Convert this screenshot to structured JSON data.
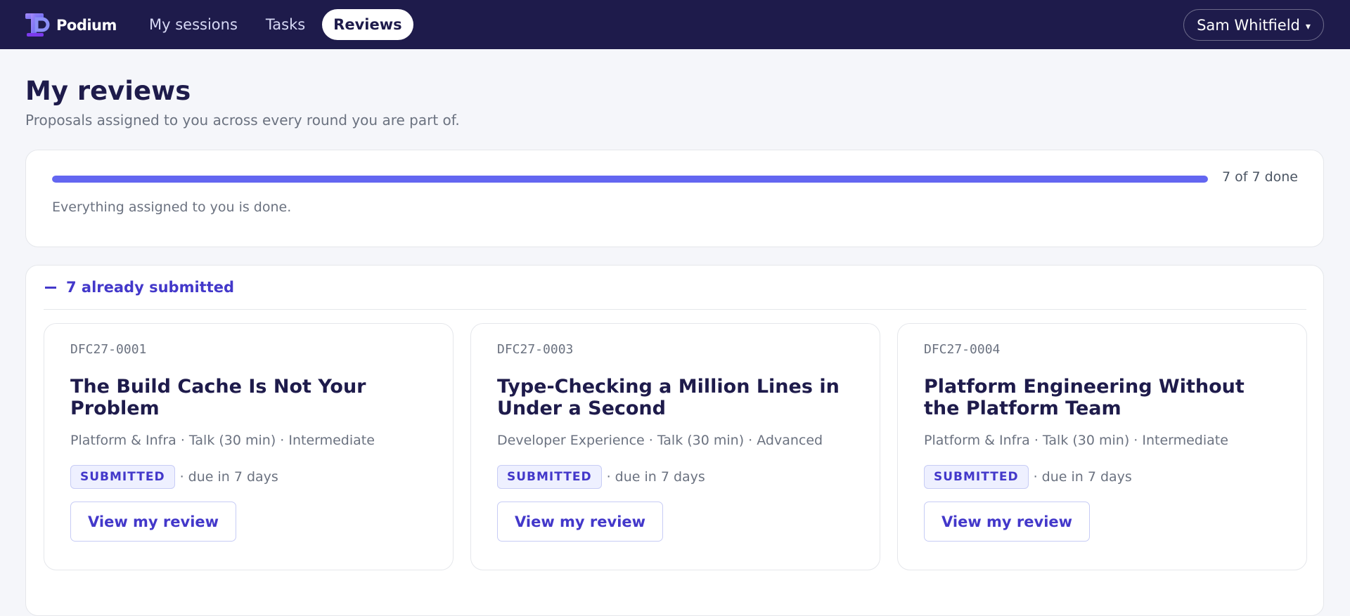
{
  "app": {
    "name": "Podium"
  },
  "nav": {
    "items": [
      {
        "label": "My sessions",
        "active": false
      },
      {
        "label": "Tasks",
        "active": false
      },
      {
        "label": "Reviews",
        "active": true
      }
    ]
  },
  "user": {
    "name": "Sam Whitfield"
  },
  "page": {
    "title": "My reviews",
    "subtitle": "Proposals assigned to you across every round you are part of."
  },
  "progress": {
    "completed": 7,
    "total": 7,
    "label": "7 of 7 done",
    "message": "Everything assigned to you is done."
  },
  "submitted": {
    "title": "7 already submitted",
    "expanded": true,
    "cards": [
      {
        "code": "DFC27-0001",
        "title": "The Build Cache Is Not Your Problem",
        "meta": "Platform & Infra · Talk (30 min) · Intermediate",
        "status": "SUBMITTED",
        "due": "· due in 7 days",
        "action": "View my review"
      },
      {
        "code": "DFC27-0003",
        "title": "Type-Checking a Million Lines in Under a Second",
        "meta": "Developer Experience · Talk (30 min) · Advanced",
        "status": "SUBMITTED",
        "due": "· due in 7 days",
        "action": "View my review"
      },
      {
        "code": "DFC27-0004",
        "title": "Platform Engineering Without the Platform Team",
        "meta": "Platform & Infra · Talk (30 min) · Intermediate",
        "status": "SUBMITTED",
        "due": "· due in 7 days",
        "action": "View my review"
      }
    ]
  },
  "colors": {
    "topbar": "#1e1b4b",
    "accent": "#6366f1",
    "link": "#4338ca"
  },
  "icons": {
    "logo": "podium-logo-icon",
    "user_menu": "caret-down-icon",
    "collapse": "minus-icon"
  }
}
